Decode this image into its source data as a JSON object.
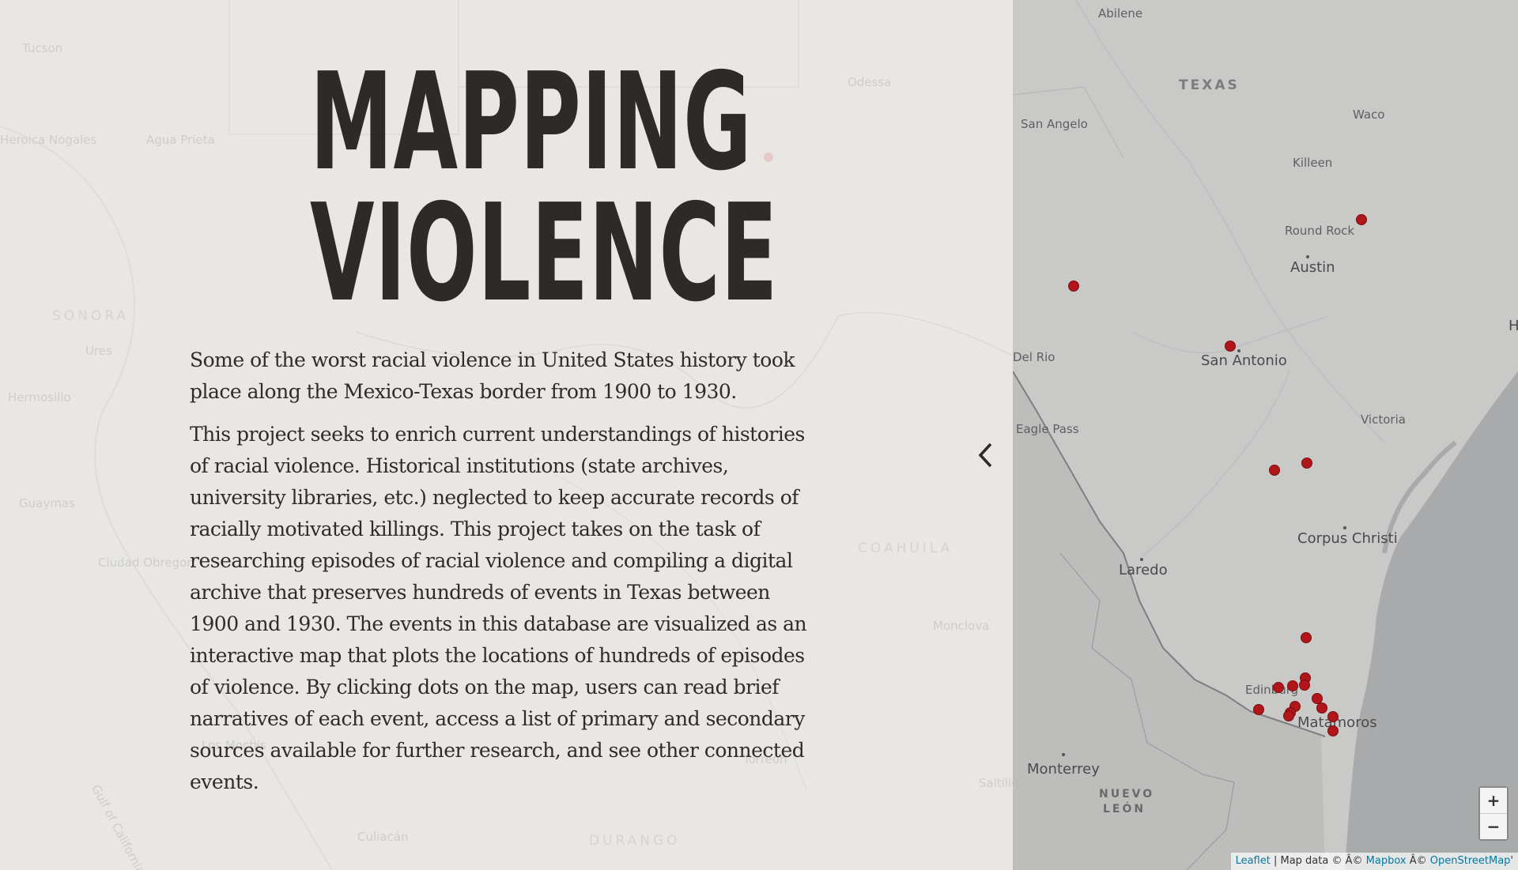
{
  "title": {
    "line1": "MAPPING",
    "line2": "VIOLENCE"
  },
  "intro": {
    "p1": "Some of the worst racial violence in United States history took place along the Mexico-Texas border from 1900 to 1930.",
    "p2": "This project seeks to enrich current understandings of histories of racial violence. Historical institutions (state archives, university libraries, etc.) neglected to keep accurate records of racially motivated killings. This project takes on the task of researching episodes of racial violence and compiling a digital archive that preserves hundreds of events in Texas between 1900 and 1930. The events in this database are visualized as an interactive map that plots the locations of hundreds of episodes of violence. By clicking dots on the map, users can read brief narratives of each event, access a list of primary and secondary sources available for further research, and see other connected events."
  },
  "background_map_labels": {
    "tucson": "Tucson",
    "heroica_nogales": "Heroica Nogales",
    "agua_prieta": "Agua Prieta",
    "sonora": "SONORA",
    "ures": "Ures",
    "hermosillo": "Hermosillo",
    "guaymas": "Guaymas",
    "ciudad_obregon": "Ciudad Obregon",
    "gulf_of_california": "Gulf of California",
    "los_mochis": "Los Mochis",
    "culiacan": "Culiacán",
    "durango": "DURANGO",
    "torreon": "Torreón",
    "coahuila": "COAHUILA",
    "monclova": "Monclova",
    "odessa": "Odessa",
    "saltillo": "Saltillo"
  },
  "map": {
    "labels": {
      "abilene": "Abilene",
      "texas": "TEXAS",
      "waco": "Waco",
      "san_angelo": "San Angelo",
      "killeen": "Killeen",
      "round_rock": "Round Rock",
      "austin": "Austin",
      "h": "H",
      "del_rio": "Del Rio",
      "san_antonio": "San Antonio",
      "victoria": "Victoria",
      "eagle_pass": "Eagle Pass",
      "corpus_christi": "Corpus Christi",
      "laredo": "Laredo",
      "edinburg": "Edinburg",
      "matamoros": "Matamoros",
      "monterrey": "Monterrey",
      "nuevo": "NUEVO",
      "leon": "LEÓN"
    },
    "zoom_in": "+",
    "zoom_out": "−",
    "attribution": {
      "leaflet": "Leaflet",
      "sep1": " | Map data © Â© ",
      "mapbox": "Mapbox",
      "sep2": " Â© ",
      "osm": "OpenStreetMap",
      "tail": "'"
    },
    "marker_color": "#b0161a"
  },
  "colors": {
    "panel_bg": "#e8e7e4",
    "title": "#2e2a28",
    "text": "#2f2b29",
    "map_land": "#c8c8c7",
    "map_water": "#a9aaab"
  }
}
